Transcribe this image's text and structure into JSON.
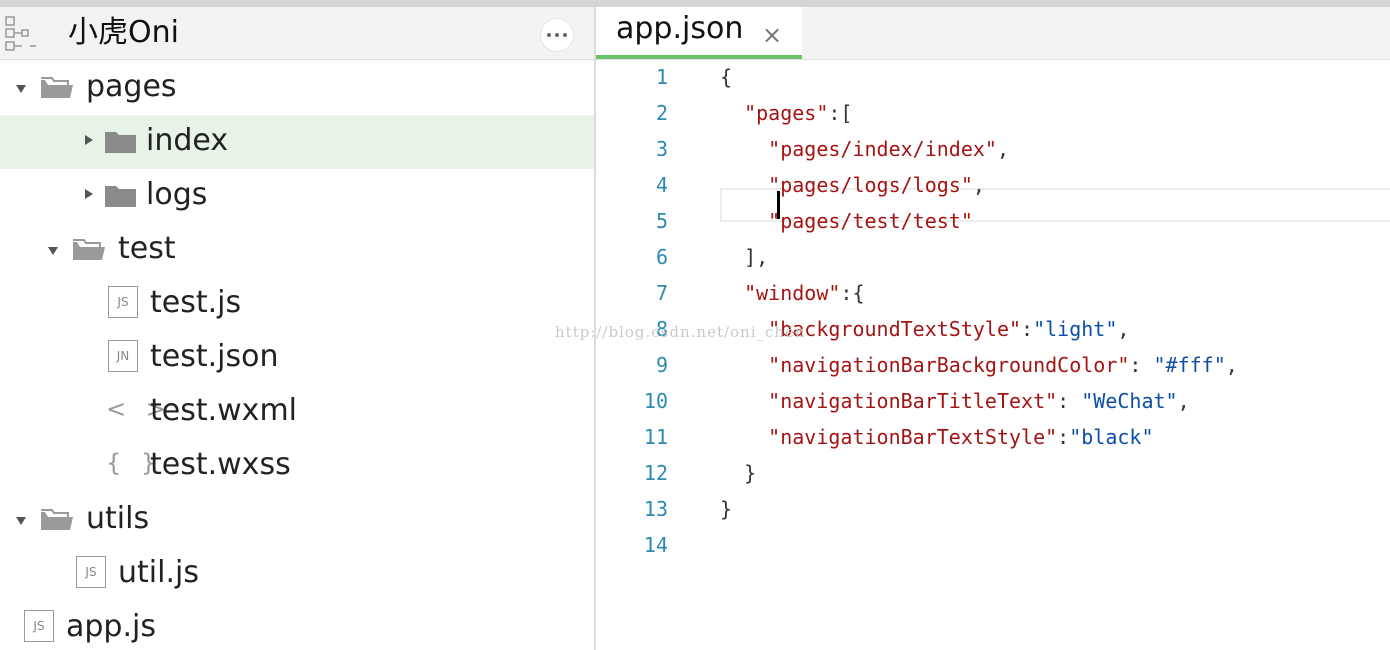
{
  "sidebar": {
    "project_name": "小虎Oni",
    "more_label": "···",
    "tree": [
      {
        "label": "pages",
        "type": "folder",
        "expanded": true,
        "depth": 0
      },
      {
        "label": "index",
        "type": "folder",
        "expanded": false,
        "depth": 1,
        "selected": true
      },
      {
        "label": "logs",
        "type": "folder",
        "expanded": false,
        "depth": 1
      },
      {
        "label": "test",
        "type": "folder",
        "expanded": true,
        "depth": 1
      },
      {
        "label": "test.js",
        "type": "js",
        "icon_text": "JS",
        "depth": 2
      },
      {
        "label": "test.json",
        "type": "json",
        "icon_text": "JN",
        "depth": 2
      },
      {
        "label": "test.wxml",
        "type": "wxml",
        "icon_text": "< >",
        "depth": 2
      },
      {
        "label": "test.wxss",
        "type": "wxss",
        "icon_text": "{ }",
        "depth": 2
      },
      {
        "label": "utils",
        "type": "folder",
        "expanded": true,
        "depth": 0
      },
      {
        "label": "util.js",
        "type": "js",
        "icon_text": "JS",
        "depth": 1
      },
      {
        "label": "app.js",
        "type": "js",
        "icon_text": "JS",
        "depth": 0
      }
    ]
  },
  "editor": {
    "tab": {
      "title": "app.json",
      "close": "×"
    },
    "line_numbers": [
      "1",
      "2",
      "3",
      "4",
      "5",
      "6",
      "7",
      "8",
      "9",
      "10",
      "11",
      "12",
      "13",
      "14"
    ],
    "lines": [
      [
        {
          "t": "p",
          "v": "{"
        }
      ],
      [
        {
          "t": "p",
          "v": "  "
        },
        {
          "t": "str",
          "v": "\"pages\""
        },
        {
          "t": "p",
          "v": ":["
        }
      ],
      [
        {
          "t": "p",
          "v": "    "
        },
        {
          "t": "str",
          "v": "\"pages/index/index\""
        },
        {
          "t": "p",
          "v": ","
        }
      ],
      [
        {
          "t": "p",
          "v": "    "
        },
        {
          "t": "str",
          "v": "\"pages/logs/logs\""
        },
        {
          "t": "p",
          "v": ","
        }
      ],
      [
        {
          "t": "p",
          "v": "    "
        },
        {
          "t": "str",
          "v": "\"pages/test/test\""
        }
      ],
      [
        {
          "t": "p",
          "v": "  ],"
        }
      ],
      [
        {
          "t": "p",
          "v": "  "
        },
        {
          "t": "str",
          "v": "\"window\""
        },
        {
          "t": "p",
          "v": ":{"
        }
      ],
      [
        {
          "t": "p",
          "v": "    "
        },
        {
          "t": "str",
          "v": "\"backgroundTextStyle\""
        },
        {
          "t": "p",
          "v": ":"
        },
        {
          "t": "val",
          "v": "\"light\""
        },
        {
          "t": "p",
          "v": ","
        }
      ],
      [
        {
          "t": "p",
          "v": "    "
        },
        {
          "t": "str",
          "v": "\"navigationBarBackgroundColor\""
        },
        {
          "t": "p",
          "v": ": "
        },
        {
          "t": "val",
          "v": "\"#fff\""
        },
        {
          "t": "p",
          "v": ","
        }
      ],
      [
        {
          "t": "p",
          "v": "    "
        },
        {
          "t": "str",
          "v": "\"navigationBarTitleText\""
        },
        {
          "t": "p",
          "v": ": "
        },
        {
          "t": "val",
          "v": "\"WeChat\""
        },
        {
          "t": "p",
          "v": ","
        }
      ],
      [
        {
          "t": "p",
          "v": "    "
        },
        {
          "t": "str",
          "v": "\"navigationBarTextStyle\""
        },
        {
          "t": "p",
          "v": ":"
        },
        {
          "t": "val",
          "v": "\"black\""
        }
      ],
      [
        {
          "t": "p",
          "v": "  }"
        }
      ],
      [
        {
          "t": "p",
          "v": "}"
        }
      ],
      [
        {
          "t": "p",
          "v": ""
        }
      ]
    ]
  },
  "watermark": "http://blog.csdn.net/oni_chen",
  "colors": {
    "accent_green": "#6cc36c",
    "string": "#a31515",
    "value": "#0b4fa6",
    "line_number": "#2b8ab0"
  }
}
